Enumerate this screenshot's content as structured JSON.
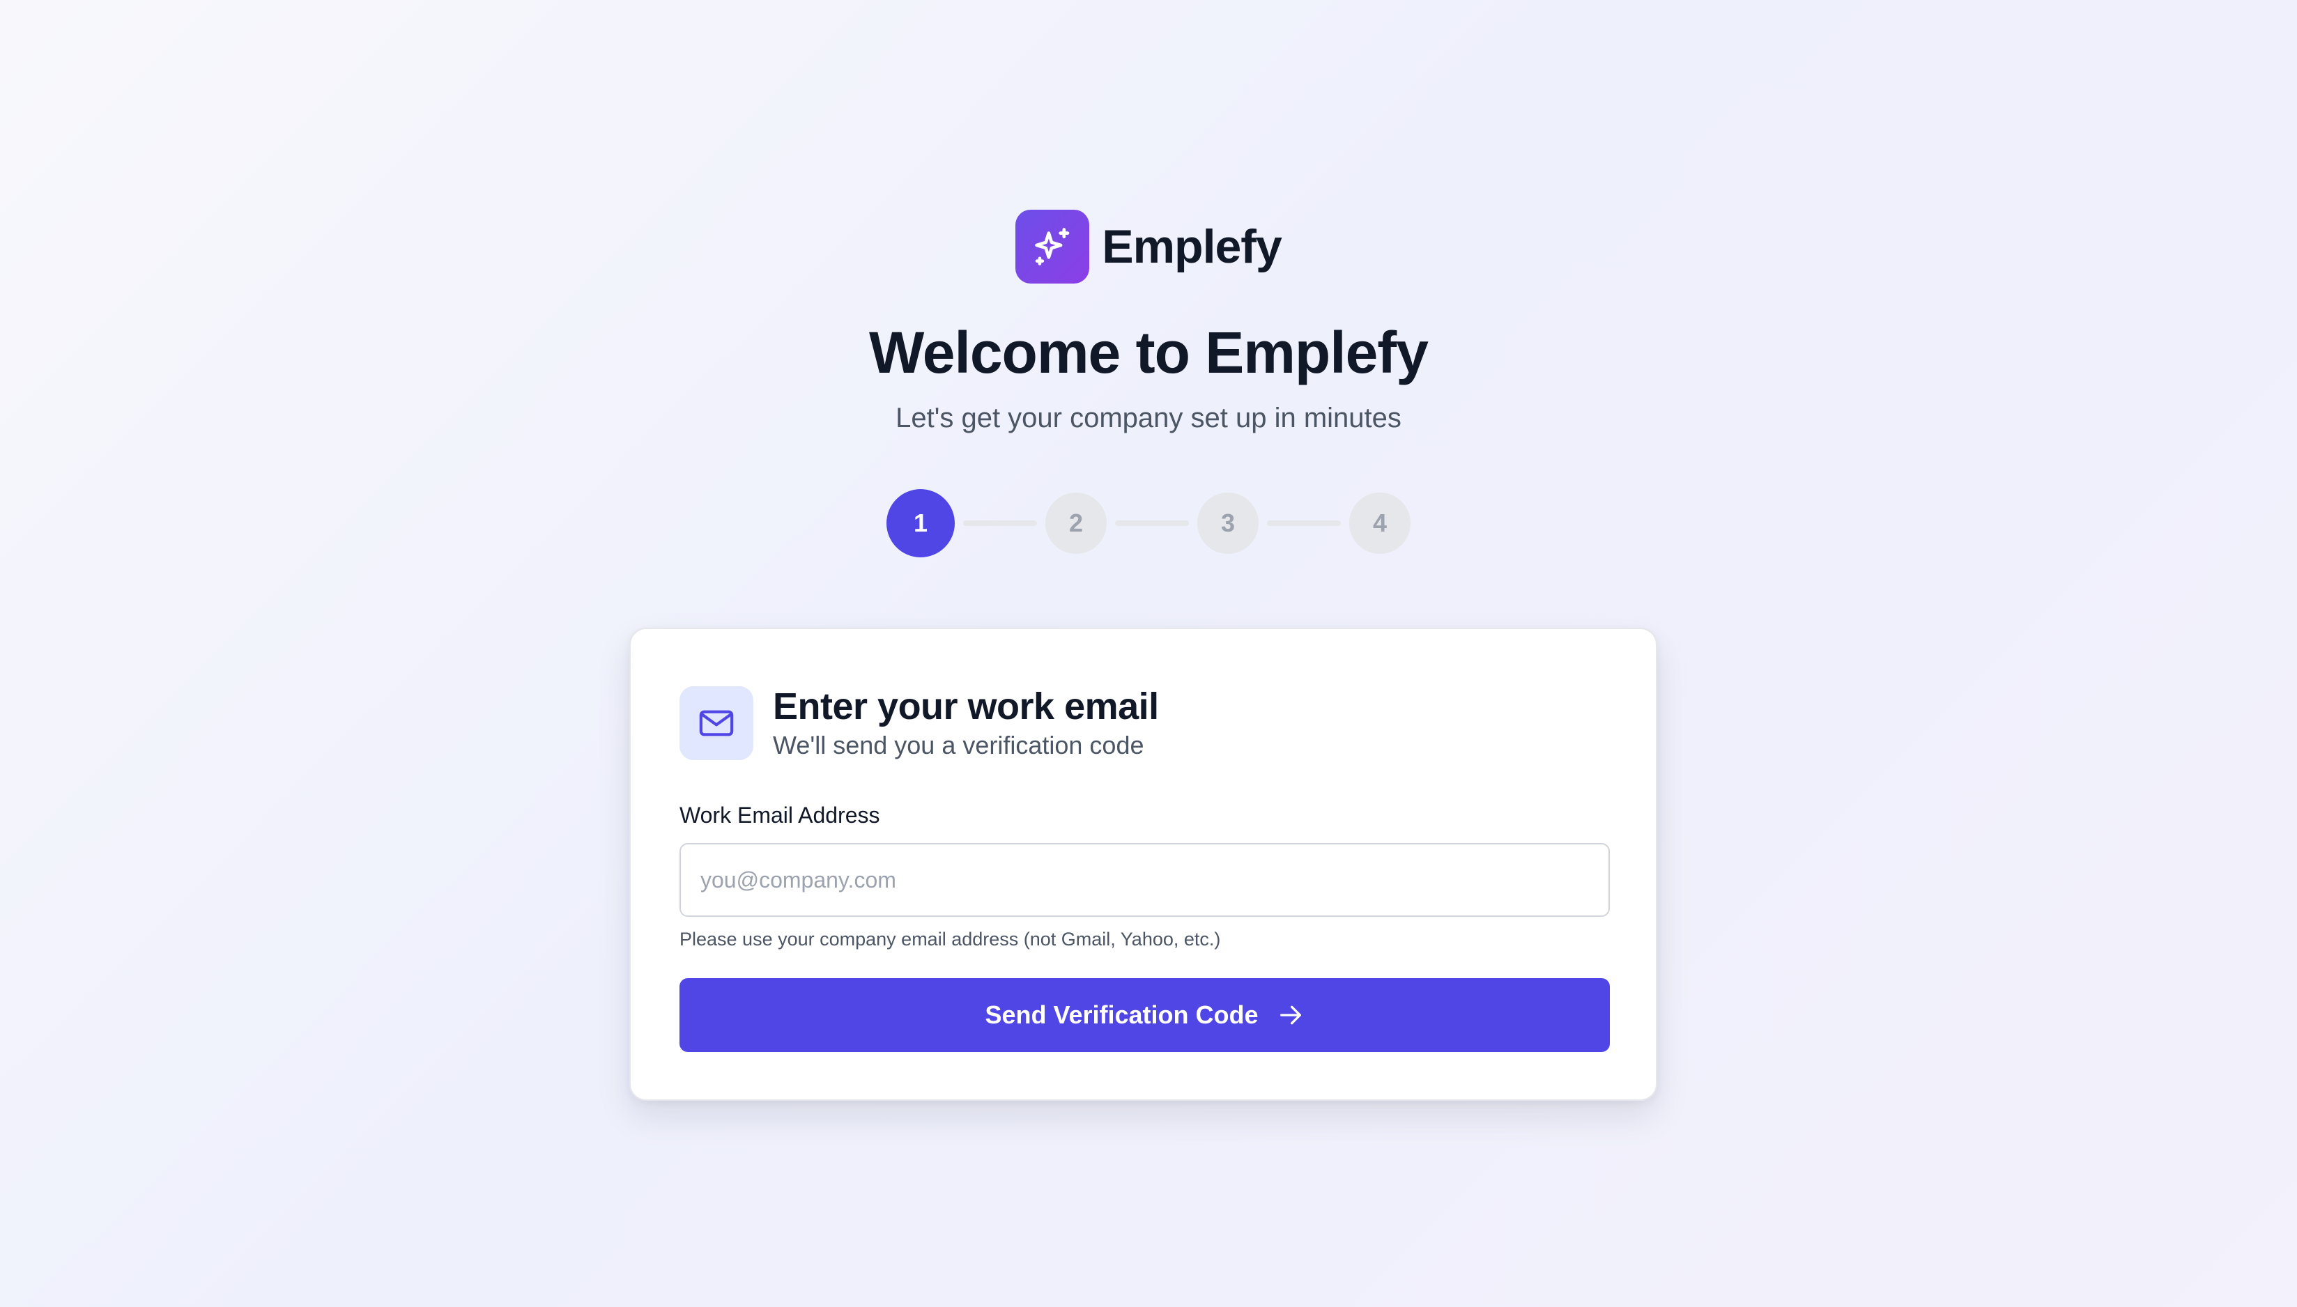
{
  "brand": {
    "name": "Emplefy",
    "logo_icon": "sparkles-icon",
    "logo_gradient": [
      "#6d4ee8",
      "#8b3fe6"
    ]
  },
  "welcome": {
    "title": "Welcome to Emplefy",
    "subtitle": "Let's get your company set up in minutes"
  },
  "stepper": {
    "current_step": 1,
    "steps": [
      {
        "label": "1",
        "state": "active"
      },
      {
        "label": "2",
        "state": "pending"
      },
      {
        "label": "3",
        "state": "pending"
      },
      {
        "label": "4",
        "state": "pending"
      }
    ]
  },
  "card": {
    "icon": "mail-icon",
    "title": "Enter your work email",
    "subtitle": "We'll send you a verification code",
    "email_label": "Work Email Address",
    "email_value": "",
    "email_placeholder": "you@company.com",
    "hint": "Please use your company email address (not Gmail, Yahoo, etc.)",
    "submit_label": "Send Verification Code",
    "submit_icon": "arrow-right-icon"
  },
  "colors": {
    "accent": "#4f46e5",
    "icon_bg": "#e0e7ff",
    "inactive_step": "#e5e7eb",
    "text_dark": "#111827",
    "text_muted": "#4b5563"
  }
}
